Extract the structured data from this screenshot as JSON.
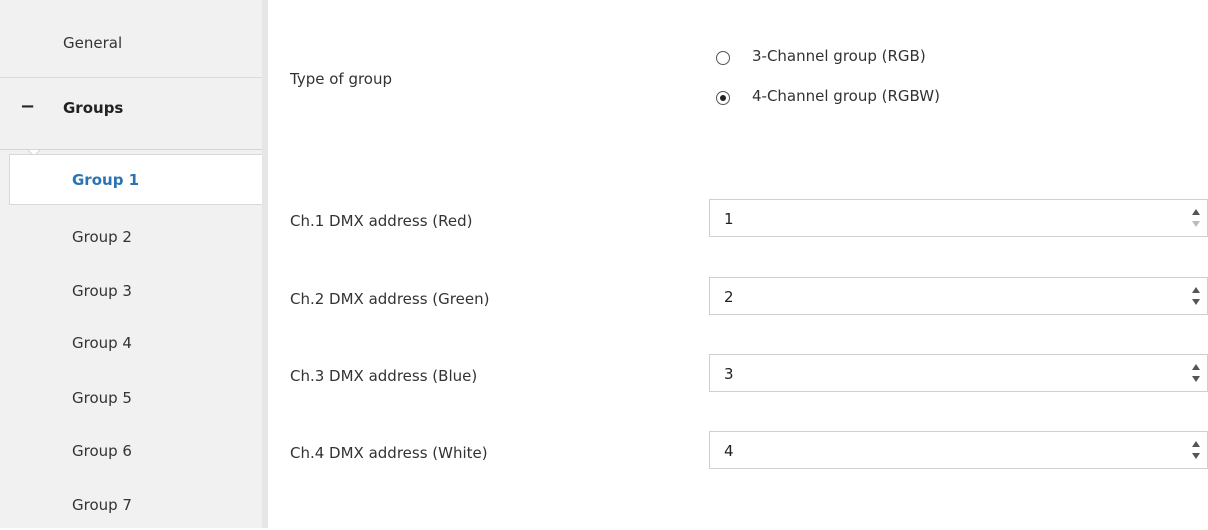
{
  "sidebar": {
    "general": "General",
    "groups": "Groups",
    "items": [
      "Group 1",
      "Group 2",
      "Group 3",
      "Group 4",
      "Group 5",
      "Group 6",
      "Group 7"
    ],
    "active_index": 0
  },
  "main": {
    "type_of_group": {
      "label": "Type of group",
      "options": [
        "3-Channel group (RGB)",
        "4-Channel group (RGBW)"
      ],
      "selected_index": 1
    },
    "fields": [
      {
        "label": "Ch.1 DMX address (Red)",
        "value": "1"
      },
      {
        "label": "Ch.2 DMX address (Green)",
        "value": "2"
      },
      {
        "label": "Ch.3 DMX address (Blue)",
        "value": "3"
      },
      {
        "label": "Ch.4 DMX address (White)",
        "value": "4"
      }
    ]
  },
  "colors": {
    "active_item": "#2b73b5",
    "sidebar_bg": "#f1f1f1"
  },
  "icons": {
    "collapse": "minus-icon",
    "spinner_up": "chevron-up-icon",
    "spinner_down": "chevron-down-icon"
  }
}
